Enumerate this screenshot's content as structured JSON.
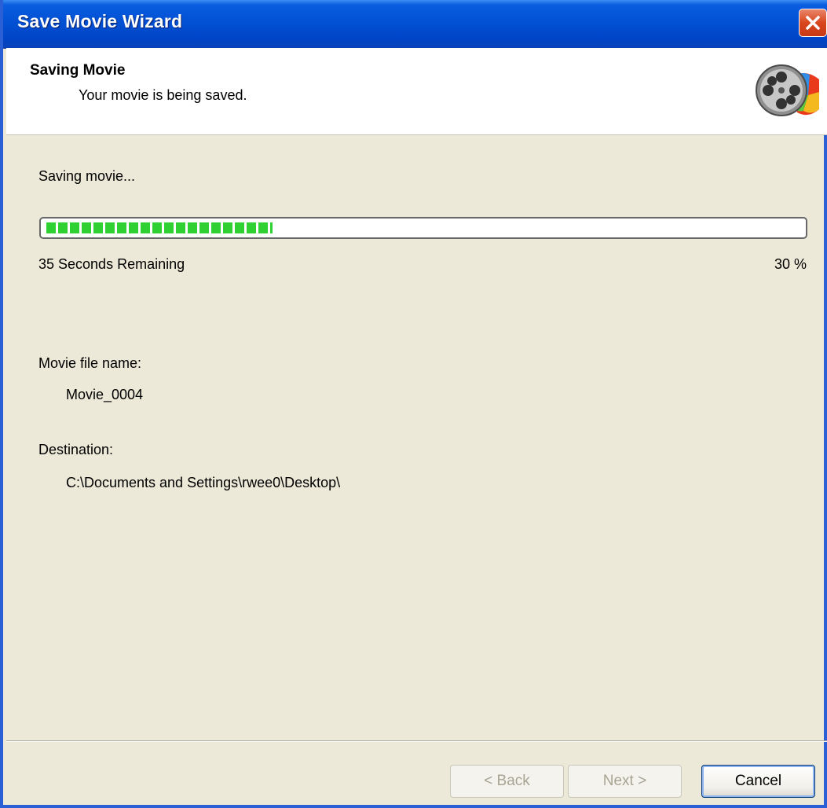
{
  "window": {
    "title": "Save Movie Wizard"
  },
  "header": {
    "title": "Saving Movie",
    "subtitle": "Your movie is being saved.",
    "icon": "movie-maker-film-reel-icon"
  },
  "status": {
    "label": "Saving movie...",
    "progress_fraction": 0.3,
    "time_remaining": "35 Seconds Remaining",
    "percent_text": "30 %"
  },
  "file": {
    "name_label": "Movie file name:",
    "name_value": "Movie_0004",
    "destination_label": "Destination:",
    "destination_value": "C:\\Documents and Settings\\rwee0\\Desktop\\"
  },
  "buttons": {
    "back": "< Back",
    "next": "Next >",
    "cancel": "Cancel"
  },
  "colors": {
    "titlebar": "#0251d4",
    "progress": "#2ed131",
    "close": "#d9461e"
  }
}
